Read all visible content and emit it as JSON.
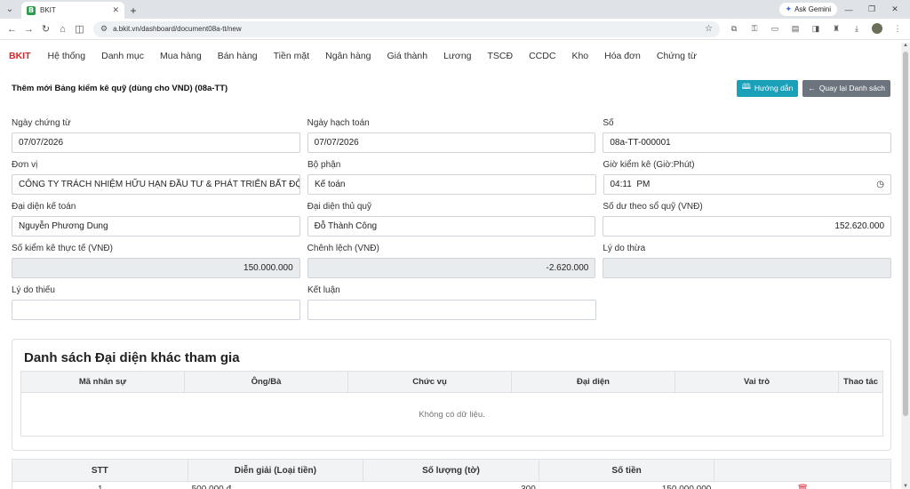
{
  "browser": {
    "tab_title": "BKIT",
    "tab_favicon": "B",
    "url": "a.bkit.vn/dashboard/document08a-tt/new",
    "gemini_label": "Ask Gemini"
  },
  "nav": {
    "brand": "BKIT",
    "items": [
      "Hệ thống",
      "Danh mục",
      "Mua hàng",
      "Bán hàng",
      "Tiền mặt",
      "Ngân hàng",
      "Giá thành",
      "Lương",
      "TSCĐ",
      "CCDC",
      "Kho",
      "Hóa đơn",
      "Chứng từ"
    ]
  },
  "header": {
    "title": "Thêm mới Bảng kiểm kê quỹ (dùng cho VND) (08a-TT)",
    "guide_button": "Hướng dẫn",
    "back_button": "Quay lại Danh sách"
  },
  "form": {
    "ngay_chung_tu": {
      "label": "Ngày chứng từ",
      "value": "07/07/2026"
    },
    "ngay_hach_toan": {
      "label": "Ngày hạch toán",
      "value": "07/07/2026"
    },
    "so": {
      "label": "Số",
      "value": "08a-TT-000001"
    },
    "don_vi": {
      "label": "Đơn vị",
      "value": "CÔNG TY TRÁCH NHIỆM HỮU HẠN ĐẦU TƯ & PHÁT TRIỂN BẤT ĐỘNG SẢN"
    },
    "bo_phan": {
      "label": "Bộ phận",
      "value": "Kế toán"
    },
    "gio_kiem_ke": {
      "label": "Giờ kiểm kê (Giờ:Phút)",
      "value": "04:11  PM"
    },
    "dai_dien_ke_toan": {
      "label": "Đại diện kế toán",
      "value": "Nguyễn Phương Dung"
    },
    "dai_dien_thu_quy": {
      "label": "Đại diện thủ quỹ",
      "value": "Đỗ Thành Công"
    },
    "so_du_theo_so_quy": {
      "label": "Số dư theo sổ quỹ (VNĐ)",
      "value": "152.620.000"
    },
    "so_kiem_ke_thuc_te": {
      "label": "Số kiểm kê thực tế (VNĐ)",
      "value": "150.000.000"
    },
    "chenh_lech": {
      "label": "Chênh lệch (VNĐ)",
      "value": "-2.620.000"
    },
    "ly_do_thua": {
      "label": "Lý do thừa",
      "value": ""
    },
    "ly_do_thieu": {
      "label": "Lý do thiếu",
      "value": ""
    },
    "ket_luan": {
      "label": "Kết luận",
      "value": ""
    }
  },
  "participants": {
    "title": "Danh sách Đại diện khác tham gia",
    "columns": [
      "Mã nhân sự",
      "Ông/Bà",
      "Chức vụ",
      "Đại diện",
      "Vai trò",
      "Thao tác"
    ],
    "empty_text": "Không có dữ liệu."
  },
  "denominations": {
    "columns": [
      "STT",
      "Diễn giải (Loại tiền)",
      "Số lượng (tờ)",
      "Số tiền",
      ""
    ],
    "rows": [
      {
        "stt": "1",
        "dien_giai": "500.000 đ",
        "so_luong": "300",
        "so_tien": "150.000.000"
      }
    ]
  }
}
